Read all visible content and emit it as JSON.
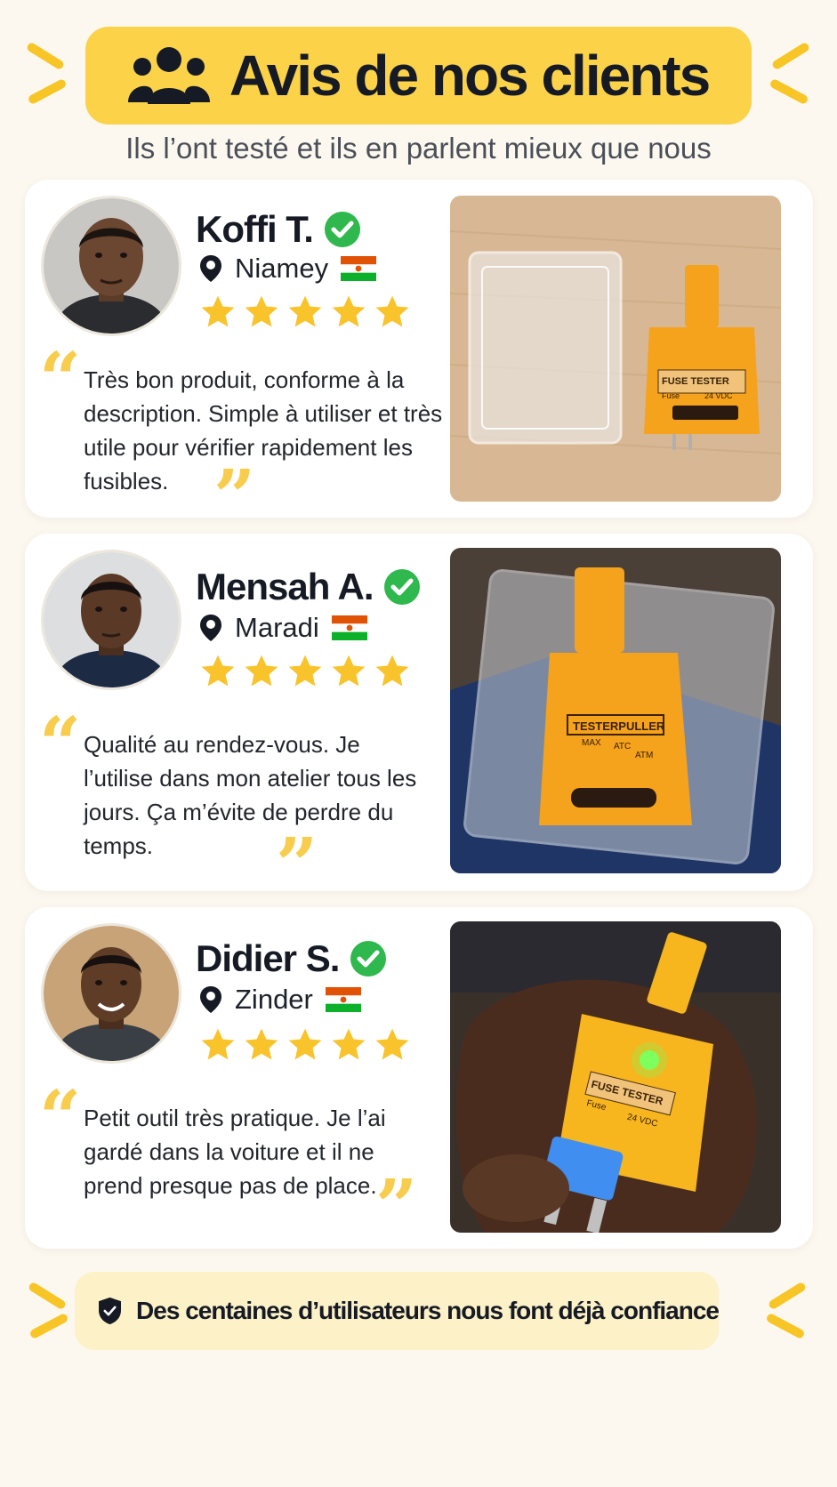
{
  "header": {
    "title": "Avis de nos clients",
    "subtitle": "Ils l’ont testé et ils en parlent mieux que nous",
    "icon": "users-icon",
    "accent_color": "#fbd248"
  },
  "reviews": [
    {
      "name": "Koffi T.",
      "city": "Niamey",
      "rating": 5,
      "quote": "Très bon produit, conforme à la description. Simple à utiliser et très utile pour vérifier rapidement les fusibles.",
      "photo_label_1": "FUSE TESTER",
      "photo_label_2": "Fuse",
      "photo_label_3": "24 VDC"
    },
    {
      "name": "Mensah A.",
      "city": "Maradi",
      "rating": 5,
      "quote": "Qualité au rendez-vous. Je l’utilise dans mon atelier tous les jours. Ça m’évite de perdre du temps.",
      "photo_label_1": "TESTERPULLER",
      "photo_label_2": "MAX",
      "photo_label_3": "ATC",
      "photo_label_4": "ATM"
    },
    {
      "name": "Didier S.",
      "city": "Zinder",
      "rating": 5,
      "quote": "Petit outil très pratique. Je l’ai gardé dans la voiture et il ne prend presque pas de place.",
      "photo_label_1": "FUSE TESTER",
      "photo_label_2": "Fuse",
      "photo_label_3": "24 VDC"
    }
  ],
  "footer": {
    "text": "Des centaines d’utilisateurs nous font déjà confiance",
    "icon": "shield-check-icon"
  },
  "colors": {
    "star": "#f9c32c",
    "verified": "#2eb84d",
    "tester_orange": "#f5a21c",
    "flag_orange": "#e05206",
    "flag_green": "#0db02b"
  }
}
